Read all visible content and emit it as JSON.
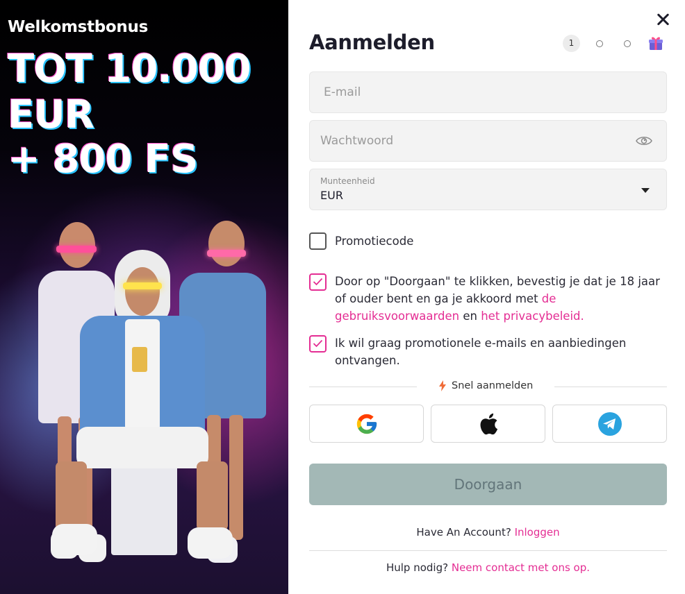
{
  "promo": {
    "subtitle": "Welkomstbonus",
    "line1": "TOT 10.000",
    "line2": "EUR",
    "line3": "+ 800 FS"
  },
  "form": {
    "title": "Aanmelden",
    "step_current": "1",
    "email_placeholder": "E-mail",
    "password_placeholder": "Wachtwoord",
    "currency_label": "Munteenheid",
    "currency_value": "EUR",
    "promo_code_label": "Promotiecode",
    "terms_text_1": "Door op \"Doorgaan\" te klikken, bevestig je dat je 18 jaar of ouder bent en ga je akkoord met ",
    "terms_link_1": "de gebruiksvoorwaarden",
    "terms_text_2": " en ",
    "terms_link_2": "het privacybeleid.",
    "promo_emails_text": "Ik wil graag promotionele e-mails en aanbiedingen ontvangen.",
    "quick_signup": "Snel aanmelden",
    "continue_button": "Doorgaan",
    "have_account": "Have An Account?",
    "login_link": "Inloggen",
    "help_text": "Hulp nodig?",
    "help_link": "Neem contact met ons op."
  },
  "colors": {
    "accent_pink": "#e42d93",
    "button_disabled": "#a3b8b6"
  },
  "icons": [
    "close-icon",
    "gift-icon",
    "eye-icon",
    "caret-down-icon",
    "checkmark-icon",
    "lightning-icon",
    "google-icon",
    "apple-icon",
    "telegram-icon"
  ]
}
